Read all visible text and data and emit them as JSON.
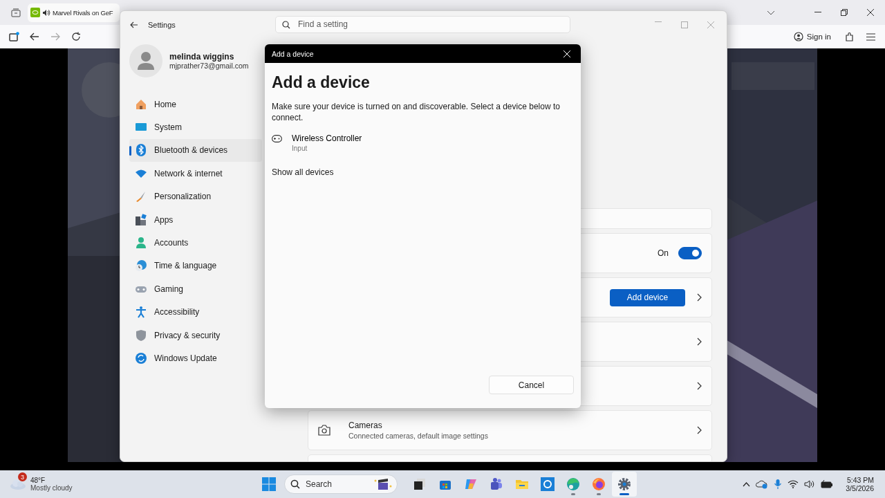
{
  "browser": {
    "tab": {
      "title": "Marvel Rivals on GeF",
      "audio": true
    },
    "sign_in": "Sign in"
  },
  "settings": {
    "title": "Settings",
    "search": {
      "placeholder": "Find a setting"
    },
    "user": {
      "name": "melinda wiggins",
      "email": "mjprather73@gmail.com"
    },
    "nav": [
      {
        "kind": "home",
        "label": "Home",
        "selected": false
      },
      {
        "kind": "system",
        "label": "System",
        "selected": false
      },
      {
        "kind": "bluetooth",
        "label": "Bluetooth & devices",
        "selected": true
      },
      {
        "kind": "network",
        "label": "Network & internet",
        "selected": false
      },
      {
        "kind": "personalization",
        "label": "Personalization",
        "selected": false
      },
      {
        "kind": "apps",
        "label": "Apps",
        "selected": false
      },
      {
        "kind": "accounts",
        "label": "Accounts",
        "selected": false
      },
      {
        "kind": "time",
        "label": "Time & language",
        "selected": false
      },
      {
        "kind": "gaming",
        "label": "Gaming",
        "selected": false
      },
      {
        "kind": "accessibility",
        "label": "Accessibility",
        "selected": false
      },
      {
        "kind": "privacy",
        "label": "Privacy & security",
        "selected": false
      },
      {
        "kind": "update",
        "label": "Windows Update",
        "selected": false
      }
    ],
    "cards": [
      {
        "kind": "blank"
      },
      {
        "kind": "toggle",
        "state_label": "On",
        "on": true
      },
      {
        "kind": "button",
        "button": "Add device"
      },
      {
        "kind": "chevron"
      },
      {
        "kind": "chevron"
      },
      {
        "kind": "detail",
        "title": "Cameras",
        "subtitle": "Connected cameras, default image settings"
      },
      {
        "kind": "blank"
      }
    ]
  },
  "dialog": {
    "title": "Add a device",
    "heading": "Add a device",
    "instructions": "Make sure your device is turned on and discoverable. Select a device below to connect.",
    "devices": [
      {
        "name": "Wireless Controller",
        "type": "Input"
      }
    ],
    "show_all": "Show all devices",
    "cancel": "Cancel"
  },
  "taskbar": {
    "weather": {
      "badge": "3",
      "temperature": "48°F",
      "condition": "Mostly cloudy"
    },
    "search": {
      "placeholder": "Search"
    },
    "apps": [
      {
        "kind": "task-view",
        "running": false,
        "selected": false
      },
      {
        "kind": "store",
        "running": false,
        "selected": false
      },
      {
        "kind": "copilot",
        "running": false,
        "selected": false
      },
      {
        "kind": "teams",
        "running": false,
        "selected": false
      },
      {
        "kind": "explorer",
        "running": false,
        "selected": false
      },
      {
        "kind": "cortana",
        "running": false,
        "selected": false
      },
      {
        "kind": "edge",
        "running": true,
        "selected": false
      },
      {
        "kind": "firefox",
        "running": true,
        "selected": false
      },
      {
        "kind": "settings",
        "running": true,
        "selected": true
      }
    ],
    "clock": {
      "time": "5:43 PM",
      "date": "3/5/2026"
    }
  }
}
